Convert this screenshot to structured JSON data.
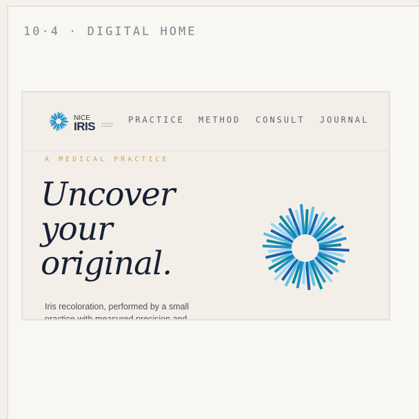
{
  "section_label": "10·4 · DIGITAL HOME",
  "site": {
    "logo": {
      "nice": "NICE",
      "iris": "IRIS",
      "tagline": "Specialist Iris Recoloration"
    },
    "nav": [
      {
        "label": "PRACTICE"
      },
      {
        "label": "METHOD"
      },
      {
        "label": "CONSULT"
      },
      {
        "label": "JOURNAL"
      }
    ],
    "hero": {
      "eyebrow": "A MEDICAL PRACTICE",
      "headline_lines": [
        "Uncover",
        "your",
        "original."
      ],
      "lede": "Iris recoloration, performed by a small practice with measured precision and"
    }
  },
  "colors": {
    "background": "#f4f0ea",
    "accent_gold": "#c9a35d",
    "ink": "#172033",
    "iris_blues": [
      "#1d5fae",
      "#2a8fd0",
      "#5cc0e8",
      "#9ad9ee",
      "#0d8a9a"
    ]
  },
  "icons": [
    "iris-logo-icon",
    "iris-burst-illustration"
  ]
}
